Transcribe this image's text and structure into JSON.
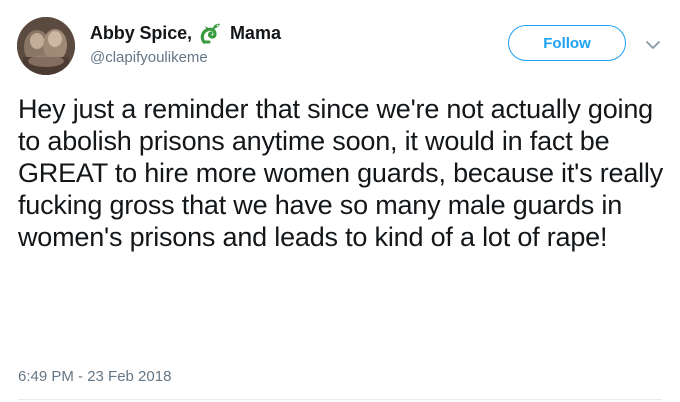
{
  "author": {
    "display_name": "Abby Spice,",
    "name_emoji": "dragon-emoji",
    "name_suffix": "Mama",
    "handle": "@clapifyoulikeme"
  },
  "actions": {
    "follow_label": "Follow",
    "menu_icon": "chevron-down-icon"
  },
  "tweet": {
    "text": "Hey just a reminder that since we're not actually going to abolish prisons anytime soon, it would in fact be GREAT to hire more women guards, because it's really fucking gross that we have so many male guards in women's prisons and leads to kind of a lot of rape!",
    "timestamp": "6:49 PM - 23 Feb 2018"
  },
  "colors": {
    "accent": "#1da1f2",
    "secondary_text": "#657786",
    "primary_text": "#14171a",
    "emoji_green": "#3a9b3e"
  }
}
